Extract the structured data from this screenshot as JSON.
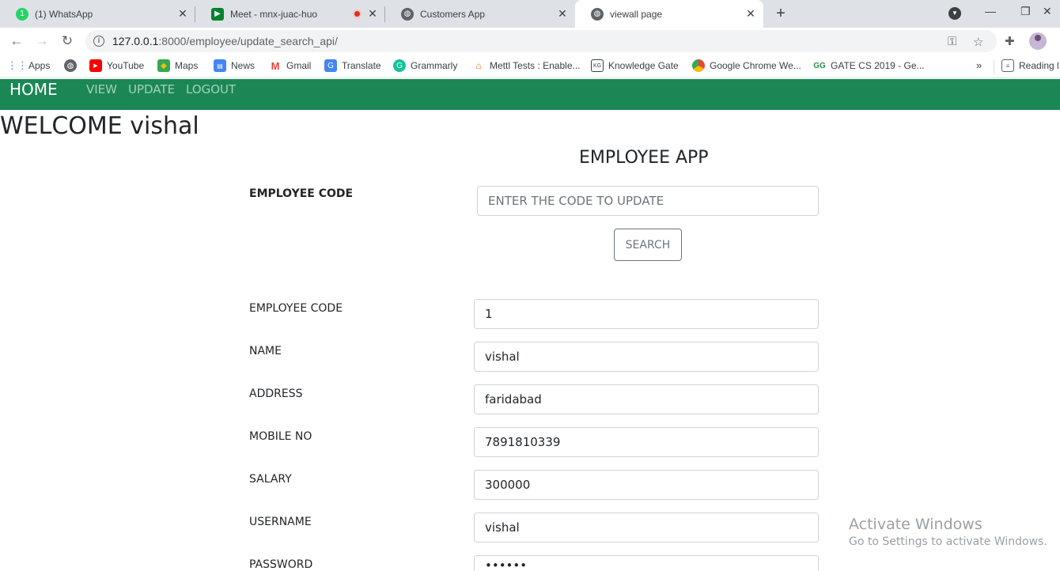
{
  "browser": {
    "tabs": [
      {
        "title": "(1) WhatsApp",
        "favicon": "whatsapp-icon"
      },
      {
        "title": "Meet - mnx-juac-huo",
        "favicon": "meet-icon",
        "recording": true
      },
      {
        "title": "Customers App",
        "favicon": "globe-icon"
      },
      {
        "title": "viewall page",
        "favicon": "globe-icon",
        "active": true
      }
    ],
    "whatsapp_badge": "1",
    "url_host": "127.0.0.1",
    "url_rest": ":8000/employee/update_search_api/",
    "bookmarks": [
      {
        "label": "Apps",
        "icon": "apps-grid-icon"
      },
      {
        "label": "",
        "icon": "globe-icon"
      },
      {
        "label": "YouTube",
        "icon": "youtube-icon"
      },
      {
        "label": "Maps",
        "icon": "maps-icon"
      },
      {
        "label": "News",
        "icon": "news-icon"
      },
      {
        "label": "Gmail",
        "icon": "gmail-icon"
      },
      {
        "label": "Translate",
        "icon": "translate-icon"
      },
      {
        "label": "Grammarly",
        "icon": "grammarly-icon"
      },
      {
        "label": "Mettl Tests : Enable...",
        "icon": "mettl-icon"
      },
      {
        "label": "Knowledge Gate",
        "icon": "knowledge-gate-icon"
      },
      {
        "label": "Google Chrome We...",
        "icon": "chrome-icon"
      },
      {
        "label": "GATE CS 2019 - Ge...",
        "icon": "geeksforgeeks-icon"
      }
    ],
    "reading_list": "Reading l"
  },
  "nav": {
    "brand": "HOME",
    "links": [
      "VIEW",
      "UPDATE",
      "LOGOUT"
    ],
    "color": "#1b8755"
  },
  "page": {
    "welcome": "WELCOME vishal",
    "app_title": "EMPLOYEE APP",
    "search_label": "EMPLOYEE CODE",
    "search_placeholder": "ENTER THE CODE TO UPDATE",
    "search_button": "SEARCH"
  },
  "form": {
    "fields": [
      {
        "label": "EMPLOYEE CODE",
        "value": "1"
      },
      {
        "label": "NAME",
        "value": "vishal"
      },
      {
        "label": "ADDRESS",
        "value": "faridabad"
      },
      {
        "label": "MOBILE NO",
        "value": "7891810339"
      },
      {
        "label": "SALARY",
        "value": "300000"
      },
      {
        "label": "USERNAME",
        "value": "vishal"
      },
      {
        "label": "PASSWORD",
        "value": "••••••"
      }
    ]
  },
  "watermark": {
    "title": "Activate Windows",
    "subtitle": "Go to Settings to activate Windows."
  }
}
